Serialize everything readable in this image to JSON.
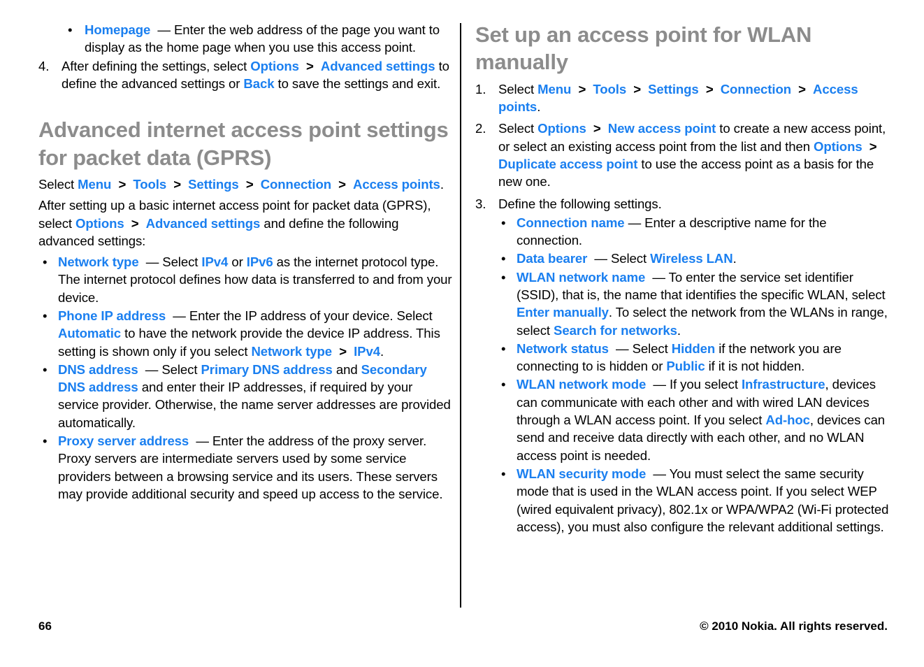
{
  "page": {
    "folio": "66",
    "copyright": "© 2010 Nokia. All rights reserved."
  },
  "left_column": {
    "continued_bullet": {
      "marker": "•",
      "term": "Homepage",
      "dash": "—",
      "body": "Enter the web address of the page you want to display as the home page when you use this access point."
    },
    "step4": {
      "marker": "4.",
      "t1": "After defining the settings, select ",
      "ui1": "Options",
      "gt1": ">",
      "ui2": "Advanced settings",
      "t2": " to define the advanced settings or ",
      "ui3": "Back",
      "t3": " to save the settings and exit."
    },
    "heading": "Advanced internet access point settings for packet data (GPRS)",
    "select_path": {
      "t1": "Select ",
      "ui1": "Menu",
      "gt1": ">",
      "ui2": "Tools",
      "gt2": ">",
      "ui3": "Settings",
      "gt3": ">",
      "ui4": "Connection",
      "gt4": ">",
      "ui5": "Access points",
      "t2": "."
    },
    "intro": {
      "t1": "After setting up a basic internet access point for packet data (GPRS), select ",
      "ui1": "Options",
      "gt1": ">",
      "ui2": "Advanced settings",
      "t2": " and define the following advanced settings:"
    },
    "bullets": [
      {
        "marker": "•",
        "term": "Network type",
        "dash": "—",
        "t1": " Select ",
        "ui1": "IPv4",
        "t2": " or ",
        "ui2": "IPv6",
        "t3": " as the internet protocol type. The internet protocol defines how data is transferred to and from your device."
      },
      {
        "marker": "•",
        "term": "Phone IP address",
        "dash": "—",
        "t1": " Enter the IP address of your device. Select ",
        "ui1": "Automatic",
        "t2": " to have the network provide the device IP address. This setting is shown only if you select ",
        "ui2": "Network type",
        "gt1": ">",
        "ui3": "IPv4",
        "t3": "."
      },
      {
        "marker": "•",
        "term": "DNS address",
        "dash": "—",
        "t1": " Select ",
        "ui1": "Primary DNS address",
        "t2": " and ",
        "ui2": "Secondary DNS address",
        "t3": " and enter their IP addresses, if required by your service provider. Otherwise, the name server addresses are provided automatically."
      },
      {
        "marker": "•",
        "term": "Proxy server address",
        "dash": "—",
        "t1": " Enter the address of the proxy server. Proxy servers are intermediate servers used by some service providers between a browsing service and its users. These servers may provide additional security and speed up access to the service."
      }
    ]
  },
  "right_column": {
    "heading": "Set up an access point for WLAN manually",
    "step1": {
      "marker": "1.",
      "t1": "Select ",
      "ui1": "Menu",
      "gt1": ">",
      "ui2": "Tools",
      "gt2": ">",
      "ui3": "Settings",
      "gt3": ">",
      "ui4": "Connection",
      "gt4": ">",
      "ui5": "Access points",
      "t2": "."
    },
    "step2": {
      "marker": "2.",
      "t1": "Select ",
      "ui1": "Options",
      "gt1": ">",
      "ui2": "New access point",
      "t2": " to create a new access point, or select an existing access point from the list and then ",
      "ui3": "Options",
      "gt2": ">",
      "ui4": "Duplicate access point",
      "t3": " to use the access point as a basis for the new one."
    },
    "step3": {
      "marker": "3.",
      "text": "Define the following settings."
    },
    "step3_bullets": [
      {
        "marker": "•",
        "term": "Connection name",
        "dash": "—",
        "t1": " Enter a descriptive name for the connection."
      },
      {
        "marker": "•",
        "term": "Data bearer",
        "dash": "—",
        "t1": " Select ",
        "ui1": "Wireless LAN",
        "t2": "."
      },
      {
        "marker": "•",
        "term": "WLAN network name",
        "dash": "—",
        "t1": " To enter the service set identifier (SSID), that is, the name that identifies the specific WLAN, select ",
        "ui1": "Enter manually",
        "t2": ". To select the network from the WLANs in range, select ",
        "ui2": "Search for networks",
        "t3": "."
      },
      {
        "marker": "•",
        "term": "Network status",
        "dash": "—",
        "t1": " Select ",
        "ui1": "Hidden",
        "t2": " if the network you are connecting to is hidden or ",
        "ui2": "Public",
        "t3": " if it is not hidden."
      },
      {
        "marker": "•",
        "term": "WLAN network mode",
        "dash": "—",
        "t1": " If you select ",
        "ui1": "Infrastructure",
        "t2": ", devices can communicate with each other and with wired LAN devices through a WLAN access point. If you select ",
        "ui2": "Ad-hoc",
        "t3": ", devices can send and receive data directly with each other, and no WLAN access point is needed."
      },
      {
        "marker": "•",
        "term": "WLAN security mode",
        "dash": "—",
        "t1": " You must select the same security mode that is used in the WLAN access point. If you select WEP (wired equivalent privacy), 802.1x or WPA/WPA2 (Wi-Fi protected access), you must also configure the relevant additional settings."
      }
    ]
  },
  "colors": {
    "ui_link": "#1a7ff0",
    "heading": "#8c8c8c",
    "body": "#000000"
  }
}
